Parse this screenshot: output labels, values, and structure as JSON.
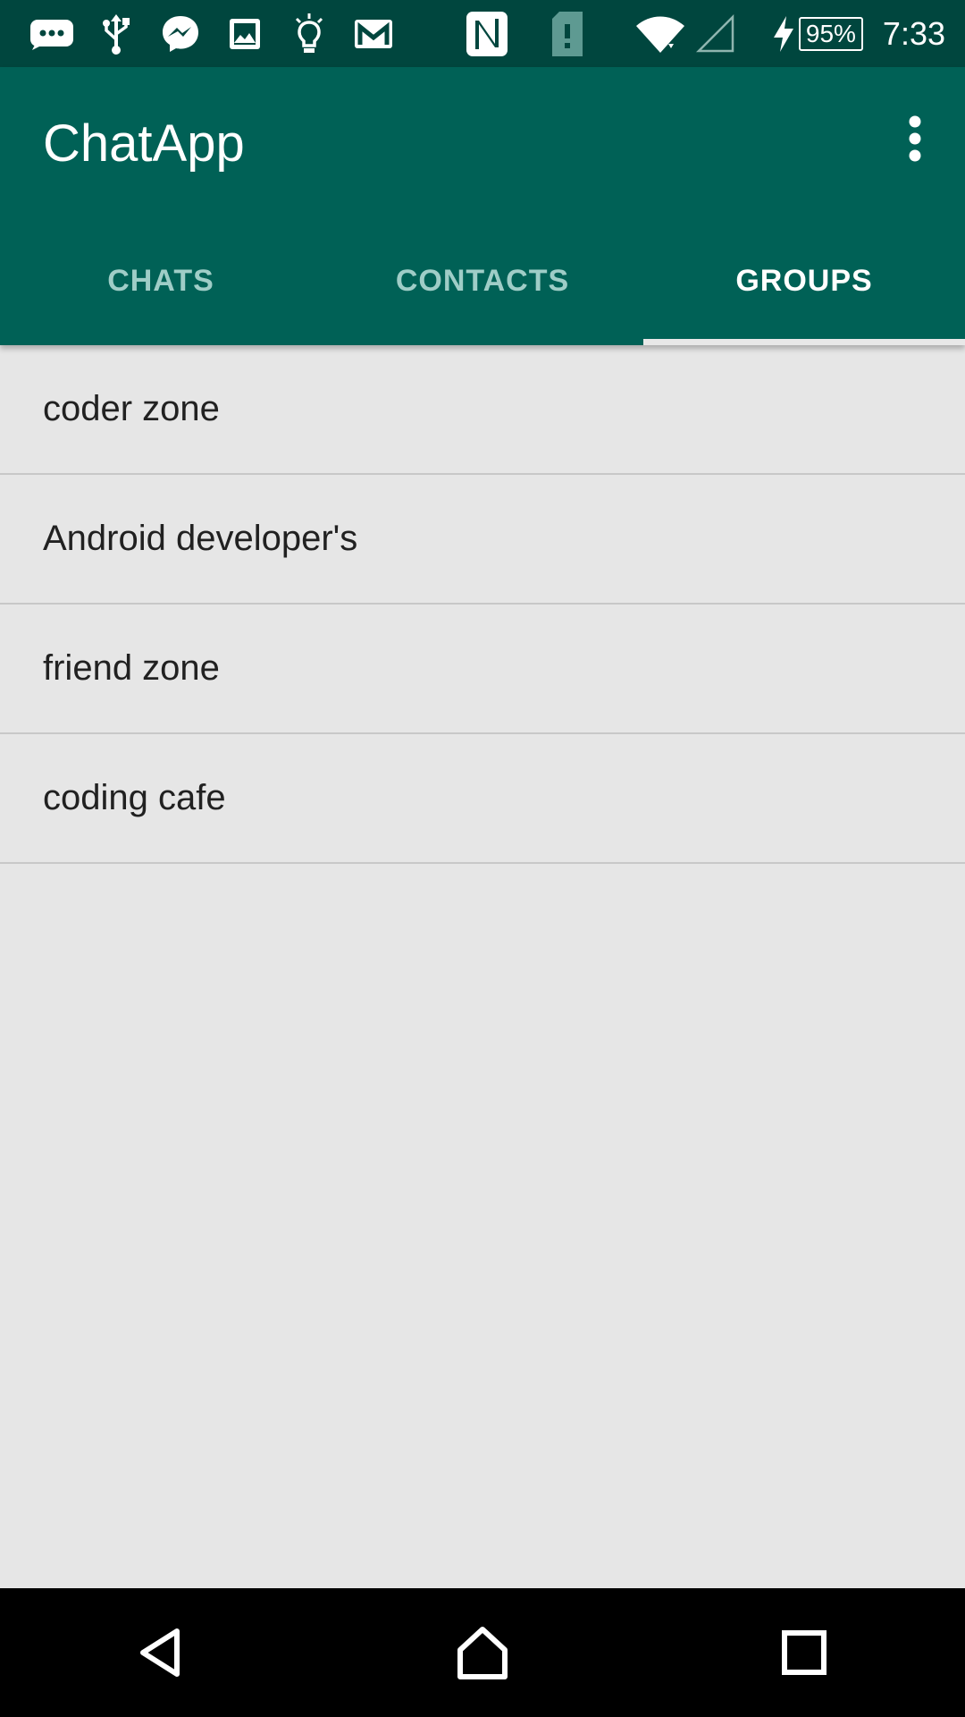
{
  "status_bar": {
    "left_icons": [
      "message-icon",
      "usb-icon",
      "messenger-icon",
      "gallery-icon",
      "lightbulb-icon",
      "gmail-icon"
    ],
    "right_icons": [
      "nfc-icon",
      "sim-alert-icon",
      "wifi-icon",
      "cell-signal-icon",
      "charging-icon"
    ],
    "battery": "95%",
    "time": "7:33"
  },
  "app_bar": {
    "title": "ChatApp",
    "menu_icon": "overflow-menu-icon",
    "color": "#006156"
  },
  "tabs": [
    {
      "label": "CHATS",
      "active": false
    },
    {
      "label": "CONTACTS",
      "active": false
    },
    {
      "label": "GROUPS",
      "active": true
    }
  ],
  "groups": [
    {
      "name": "coder zone"
    },
    {
      "name": "Android developer's"
    },
    {
      "name": "friend zone"
    },
    {
      "name": "coding cafe"
    }
  ],
  "nav_bar": {
    "buttons": [
      "back-icon",
      "home-icon",
      "recents-icon"
    ]
  },
  "colors": {
    "status_bar": "#00463e",
    "primary": "#006156",
    "background": "#e6e6e6",
    "inactive_tab": "#9fcdc7"
  }
}
